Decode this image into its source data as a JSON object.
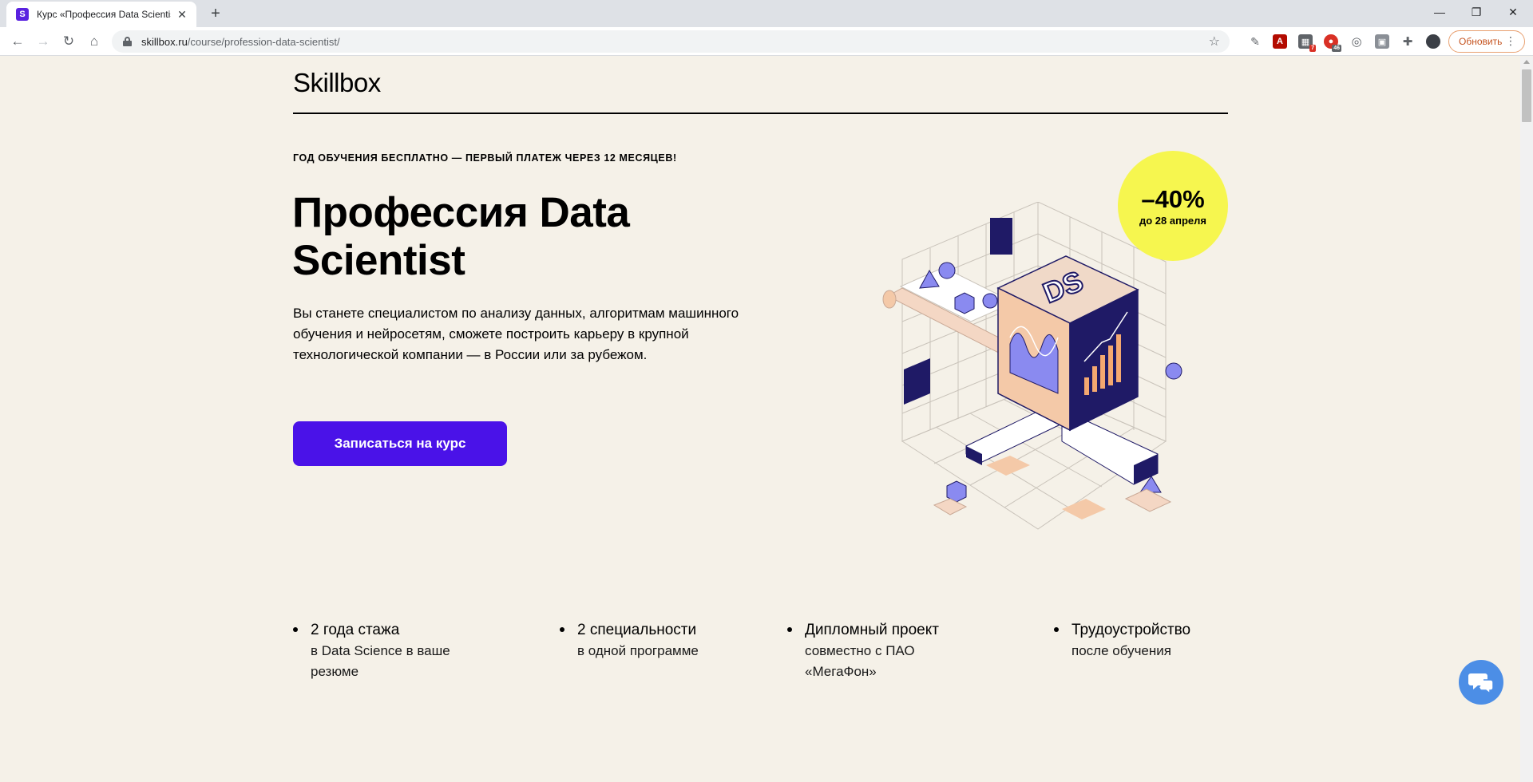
{
  "browser": {
    "tab_title": "Курс «Профессия Data Scientist",
    "favicon_letter": "S",
    "new_tab": "+",
    "url_host": "skillbox.ru",
    "url_path": "/course/profession-data-scientist/",
    "update_button": "Обновить",
    "ext_badges": [
      "7",
      "46"
    ]
  },
  "header": {
    "logo": "Skillbox"
  },
  "hero": {
    "promo": "ГОД ОБУЧЕНИЯ БЕСПЛАТНО — ПЕРВЫЙ ПЛАТЕЖ ЧЕРЕЗ 12 МЕСЯЦЕВ!",
    "title_line1": "Профессия Data",
    "title_line2": "Scientist",
    "lead": "Вы станете специалистом по анализу данных, алгоритмам машинного обучения и нейросетям, сможете построить карьеру в крупной технологической компании — в России или за рубежом.",
    "cta": "Записаться на курс",
    "sale_percent": "–40%",
    "sale_until": "до 28 апреля",
    "cube_label": "DS"
  },
  "features": [
    {
      "title": "2 года стажа",
      "desc_line1": "в Data Science в ваше",
      "desc_line2": "резюме"
    },
    {
      "title": "2 специальности",
      "desc_line1": "в одной программе",
      "desc_line2": ""
    },
    {
      "title": "Дипломный проект",
      "desc_line1": "совместно с ПАО",
      "desc_line2": "«МегаФон»"
    },
    {
      "title": "Трудоустройство",
      "desc_line1": "после обучения",
      "desc_line2": ""
    }
  ],
  "colors": {
    "accent": "#4a12e8",
    "sale": "#f6f64f",
    "background": "#f5f1e8",
    "navy": "#1f1a66",
    "peach": "#f4c9a8"
  }
}
